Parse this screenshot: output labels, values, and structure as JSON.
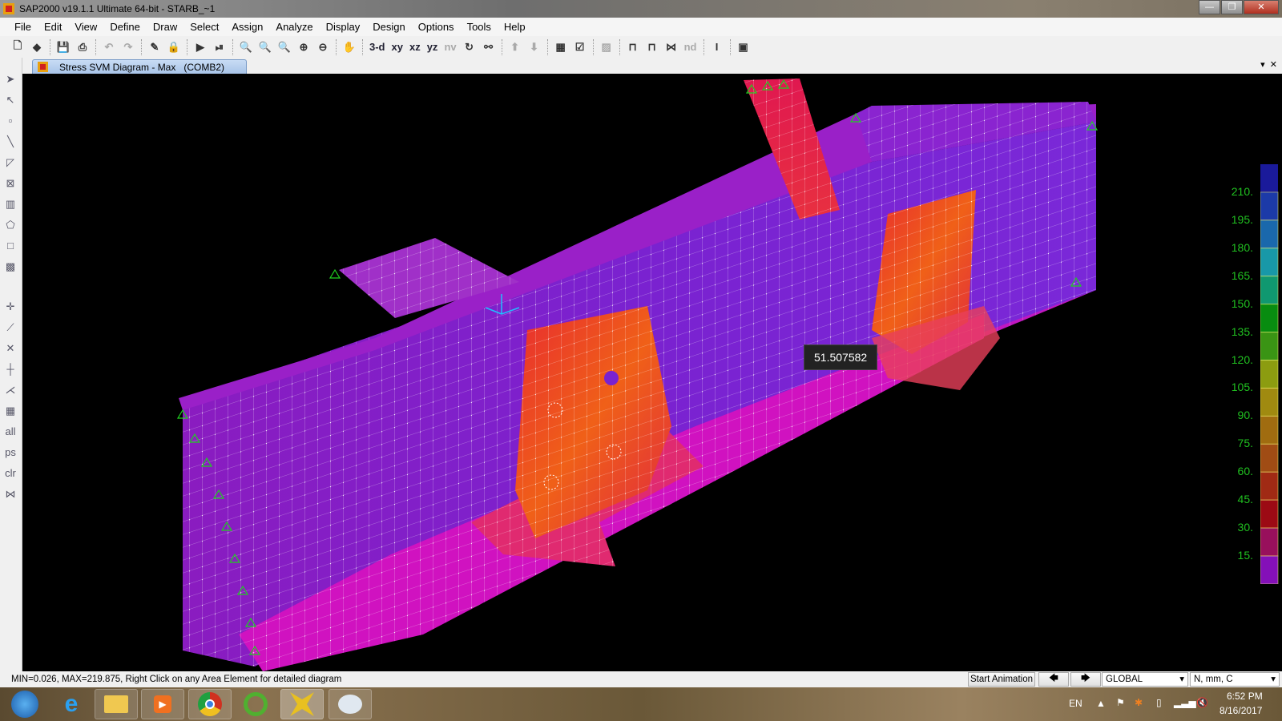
{
  "window": {
    "title": "SAP2000 v19.1.1 Ultimate 64-bit - STARB_~1",
    "controls": [
      "minimize",
      "maximize",
      "close"
    ]
  },
  "menu": [
    "File",
    "Edit",
    "View",
    "Define",
    "Draw",
    "Select",
    "Assign",
    "Analyze",
    "Display",
    "Design",
    "Options",
    "Tools",
    "Help"
  ],
  "toolbar": {
    "view_labels": {
      "three_d": "3-d",
      "xy": "xy",
      "xz": "xz",
      "yz": "yz",
      "nv": "nv",
      "nd": "nd"
    }
  },
  "tab": {
    "label": "Stress SVM Diagram - Max   (COMB2)"
  },
  "viewport": {
    "tooltip": "51.507582"
  },
  "legend": {
    "labels": [
      "210.",
      "195.",
      "180.",
      "165.",
      "150.",
      "135.",
      "120.",
      "105.",
      "90.",
      "75.",
      "60.",
      "45.",
      "30.",
      "15."
    ],
    "colors": [
      "#1a1a9a",
      "#1c3aa8",
      "#1a68ac",
      "#1898a8",
      "#109870",
      "#088c10",
      "#3a9414",
      "#8c9c10",
      "#a08a10",
      "#a06c10",
      "#a04c14",
      "#a02a14",
      "#9c0a14",
      "#98105c",
      "#8410b8"
    ]
  },
  "status": {
    "text": "MIN=0.026, MAX=219.875, Right Click on any Area Element for detailed diagram",
    "start_animation": "Start Animation",
    "coord_system": "GLOBAL",
    "units": "N, mm, C"
  },
  "taskbar": {
    "apps": [
      "start",
      "internet-explorer",
      "file-explorer",
      "media-player",
      "chrome",
      "coc-coc",
      "sap2000",
      "paint"
    ],
    "tray": {
      "lang": "EN",
      "time": "6:52 PM",
      "date": "8/16/2017"
    }
  }
}
